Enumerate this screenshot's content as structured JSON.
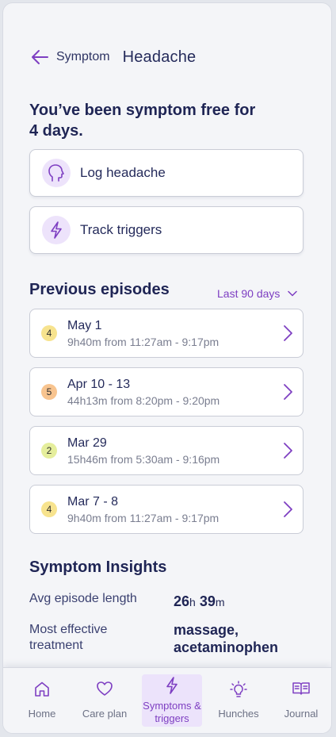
{
  "header": {
    "crumb": "Symptom",
    "title": "Headache"
  },
  "status_text": "You’ve been symptom free for 4 days.",
  "actions": [
    {
      "label": "Log headache",
      "icon": "head-icon"
    },
    {
      "label": "Track triggers",
      "icon": "lightning-icon"
    }
  ],
  "episodes_section": {
    "title": "Previous episodes",
    "filter": "Last 90 days"
  },
  "episodes": [
    {
      "severity": "4",
      "severity_color": "#f7e38e",
      "date": "May 1",
      "duration_h": "9h",
      "duration_m": "40m",
      "range": "from 11:27am - 9:17pm"
    },
    {
      "severity": "5",
      "severity_color": "#f8c48f",
      "date": "Apr 10 - 13",
      "duration_h": "44h",
      "duration_m": "13m",
      "range": "from 8:20pm - 9:20pm"
    },
    {
      "severity": "2",
      "severity_color": "#e5ee9c",
      "date": "Mar 29",
      "duration_h": "15h",
      "duration_m": "46m",
      "range": "from 5:30am - 9:16pm"
    },
    {
      "severity": "4",
      "severity_color": "#f7e38e",
      "date": "Mar 7 - 8",
      "duration_h": "9h",
      "duration_m": "40m",
      "range": "from 11:27am - 9:17pm"
    }
  ],
  "insights": {
    "title": "Symptom Insights",
    "avg_label": "Avg episode length",
    "avg_hours": "26",
    "avg_hours_unit": "h",
    "avg_minutes": "39",
    "avg_minutes_unit": "m",
    "treatment_label": "Most effective treatment",
    "treatment_value": "massage, acetaminophen"
  },
  "nav": [
    {
      "label": "Home",
      "icon": "home-icon",
      "active": false
    },
    {
      "label": "Care plan",
      "icon": "heart-icon",
      "active": false
    },
    {
      "label": "Symptoms & triggers",
      "icon": "lightning-icon",
      "active": true
    },
    {
      "label": "Hunches",
      "icon": "lightbulb-icon",
      "active": false
    },
    {
      "label": "Journal",
      "icon": "book-icon",
      "active": false
    }
  ],
  "colors": {
    "accent": "#7e3fc2",
    "accent_light": "#ede3fb",
    "text_dark": "#1f2555"
  }
}
